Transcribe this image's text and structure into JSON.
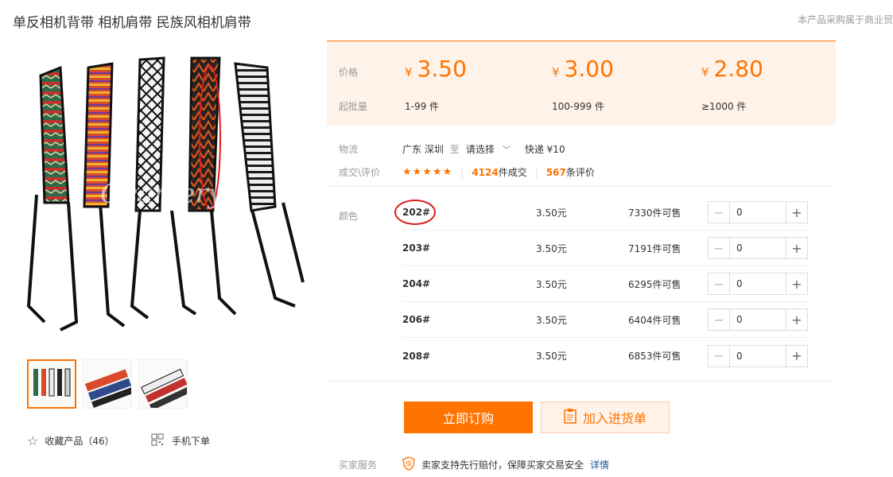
{
  "title": "单反相机背带 相机肩带 民族风相机肩带",
  "notice": "本产品采购属于商业贸",
  "gallery": {
    "watermark": "Ocamery"
  },
  "favorite": {
    "label": "收藏产品（46）"
  },
  "mobile_order": {
    "label": "手机下单"
  },
  "price": {
    "price_label": "价格",
    "qty_label": "起批量",
    "currency": "¥",
    "tiers": [
      {
        "price": "3.50",
        "qty": "1-99 件"
      },
      {
        "price": "3.00",
        "qty": "100-999 件"
      },
      {
        "price": "2.80",
        "qty": "≥1000 件"
      }
    ]
  },
  "logistics": {
    "label": "物流",
    "from": "广东 深圳",
    "to_word": "至",
    "select": "请选择",
    "express": "快递 ¥10"
  },
  "reviews": {
    "label": "成交\\评价",
    "stars": "★★★★★",
    "deals_count": "4124",
    "deals_suffix": "件成交",
    "reviews_count": "567",
    "reviews_suffix": "条评价"
  },
  "sku": {
    "label": "颜色",
    "rows": [
      {
        "name": "202#",
        "price": "3.50元",
        "stock": "7330件可售",
        "qty": "0"
      },
      {
        "name": "203#",
        "price": "3.50元",
        "stock": "7191件可售",
        "qty": "0"
      },
      {
        "name": "204#",
        "price": "3.50元",
        "stock": "6295件可售",
        "qty": "0"
      },
      {
        "name": "206#",
        "price": "3.50元",
        "stock": "6404件可售",
        "qty": "0"
      },
      {
        "name": "208#",
        "price": "3.50元",
        "stock": "6853件可售",
        "qty": "0"
      }
    ]
  },
  "actions": {
    "buy": "立即订购",
    "cart": "加入进货单"
  },
  "service": {
    "label": "买家服务",
    "text": "卖家支持先行赔付，保障买家交易安全",
    "link": "详情"
  },
  "colors": {
    "accent": "#ff7300",
    "price_bg": "#fff2e8",
    "highlight_red": "#d8201c"
  }
}
